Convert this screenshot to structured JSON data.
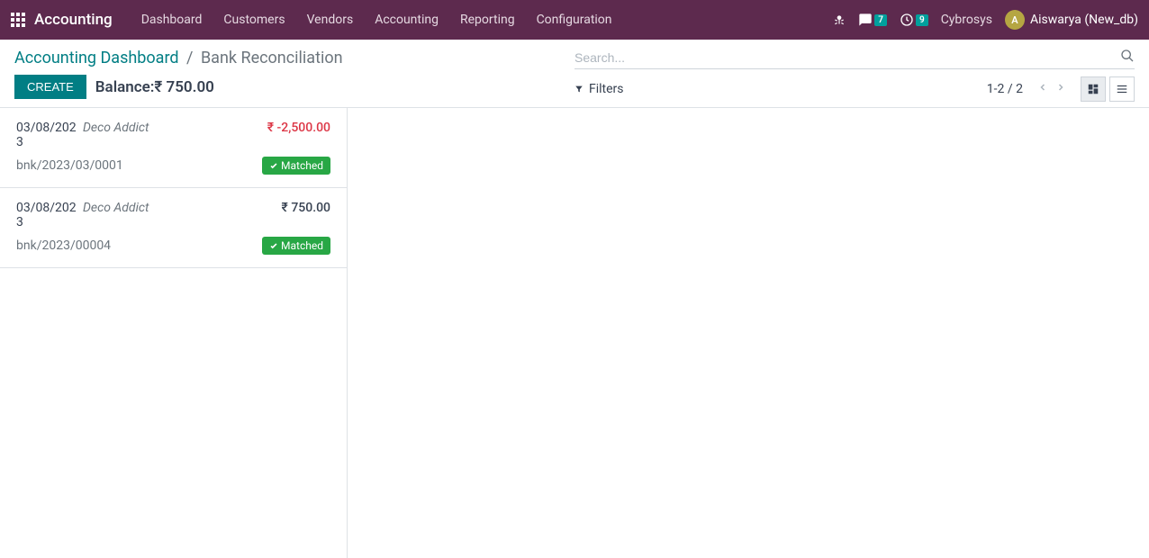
{
  "navbar": {
    "brand": "Accounting",
    "items": [
      "Dashboard",
      "Customers",
      "Vendors",
      "Accounting",
      "Reporting",
      "Configuration"
    ],
    "chat_badge": "7",
    "activity_badge": "9",
    "company": "Cybrosys",
    "user_initial": "A",
    "user_name": "Aiswarya (New_db)"
  },
  "breadcrumb": {
    "parent": "Accounting Dashboard",
    "current": "Bank Reconciliation"
  },
  "actions": {
    "create": "CREATE",
    "balance_label": "Balance:",
    "balance_value": "₹ 750.00"
  },
  "search": {
    "placeholder": "Search...",
    "filters_label": "Filters"
  },
  "pager": {
    "text": "1-2 / 2"
  },
  "records": [
    {
      "date": "03/08/2023",
      "partner": "Deco Addict",
      "amount": "₹ -2,500.00",
      "negative": true,
      "ref": "bnk/2023/03/0001",
      "status": "Matched"
    },
    {
      "date": "03/08/2023",
      "partner": "Deco Addict",
      "amount": "₹ 750.00",
      "negative": false,
      "ref": "bnk/2023/00004",
      "status": "Matched"
    }
  ]
}
